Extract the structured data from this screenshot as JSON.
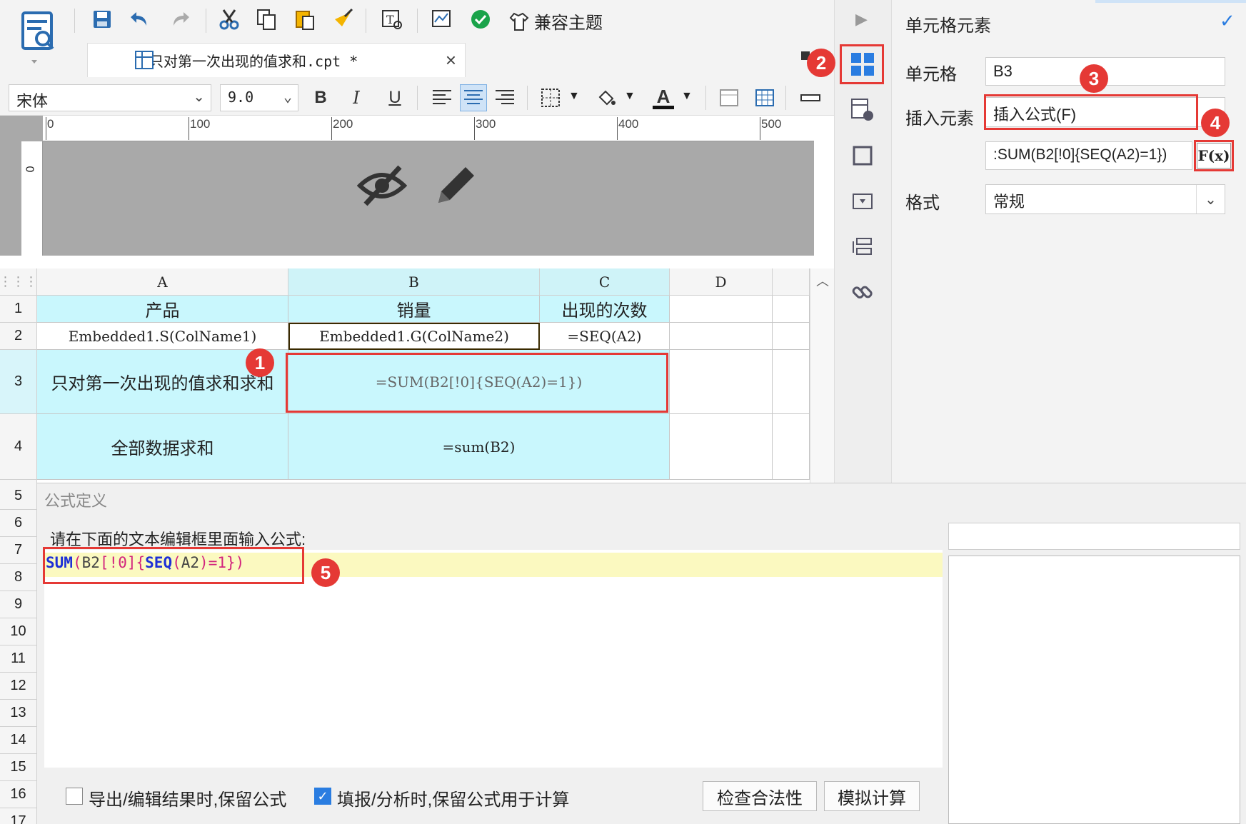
{
  "toolbar": {
    "theme_label": "兼容主题",
    "file_tab": "只对第一次出现的值求和.cpt *",
    "font_name": "宋体",
    "font_size": "9.0",
    "bold_label": "B",
    "italic_label": "I",
    "underline_label": "U",
    "text_color_label": "A"
  },
  "ruler": {
    "ticks": [
      "0",
      "100",
      "200",
      "300",
      "400",
      "500"
    ],
    "left_tick": "0"
  },
  "grid": {
    "columns": [
      "A",
      "B",
      "C",
      "D"
    ],
    "rows": [
      "1",
      "2",
      "3",
      "4",
      "5",
      "6",
      "7",
      "8",
      "9",
      "10",
      "11",
      "12",
      "13",
      "14",
      "15",
      "16",
      "17"
    ],
    "cells": {
      "A1": "产品",
      "B1": "销量",
      "C1": "出现的次数",
      "A2": "Embedded1.S(ColName1)",
      "B2": "Embedded1.G(ColName2)",
      "C2": "=SEQ(A2)",
      "A3": "只对第一次出现的值求和求和",
      "B3": "=SUM(B2[!0]{SEQ(A2)=1})",
      "A4": "全部数据求和",
      "B4": "=sum(B2)"
    }
  },
  "right_panel": {
    "title": "单元格元素",
    "cell_label": "单元格",
    "cell_value": "B3",
    "insert_label": "插入元素",
    "insert_value": "插入公式(F)",
    "formula_value": ":SUM(B2[!0]{SEQ(A2)=1})",
    "fx_label": "F(x)",
    "format_label": "格式",
    "format_value": "常规"
  },
  "badges": [
    "1",
    "2",
    "3",
    "4",
    "5"
  ],
  "dialog": {
    "title": "公式定义",
    "prompt": "请在下面的文本编辑框里面输入公式:",
    "formula_tokens": {
      "fn1": "SUM",
      "p1": "(",
      "ref1": "B2",
      "b1": "[",
      "bang": "!0",
      "b2": "]",
      "c1": "{",
      "fn2": "SEQ",
      "p2": "(",
      "ref2": "A2",
      "p3": ")",
      "eq": "=1",
      "c2": "}",
      "p4": ")"
    },
    "check1_label": "导出/编辑结果时,保留公式",
    "check1_checked": false,
    "check2_label": "填报/分析时,保留公式用于计算",
    "check2_checked": true,
    "validate_button": "检查合法性",
    "simulate_button": "模拟计算"
  },
  "colors": {
    "accent": "#2a7de1",
    "selection": "#c9f7fd",
    "highlight": "#e53935"
  }
}
